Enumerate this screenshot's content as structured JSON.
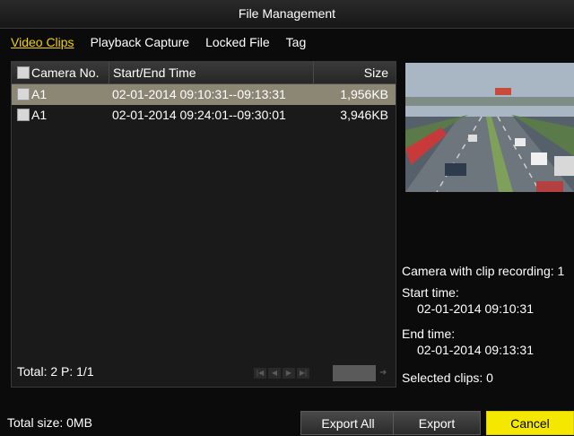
{
  "window": {
    "title": "File Management"
  },
  "tabs": [
    {
      "label": "Video Clips",
      "active": true
    },
    {
      "label": "Playback Capture",
      "active": false
    },
    {
      "label": "Locked File",
      "active": false
    },
    {
      "label": "Tag",
      "active": false
    }
  ],
  "table": {
    "headers": {
      "camera": "Camera No.",
      "time": "Start/End Time",
      "size": "Size"
    },
    "rows": [
      {
        "camera": "A1",
        "time": "02-01-2014 09:10:31--09:13:31",
        "size": "1,956KB",
        "selected": true
      },
      {
        "camera": "A1",
        "time": "02-01-2014 09:24:01--09:30:01",
        "size": "3,946KB",
        "selected": false
      }
    ]
  },
  "footer": {
    "total": "Total: 2  P: 1/1"
  },
  "details": {
    "camera_recording": "Camera with clip recording: 1",
    "start_label": "Start time:",
    "start_value": "02-01-2014 09:10:31",
    "end_label": "End time:",
    "end_value": "02-01-2014 09:13:31",
    "selected": "Selected clips: 0"
  },
  "bottom": {
    "total_size": "Total size: 0MB",
    "export_all": "Export All",
    "export": "Export",
    "cancel": "Cancel"
  },
  "colors": {
    "accent_tab": "#f2d000",
    "cancel_bg": "#f4e800",
    "row_selected": "#8c8775"
  }
}
